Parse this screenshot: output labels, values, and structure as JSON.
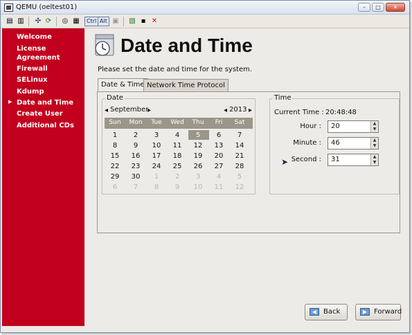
{
  "window": {
    "title": "QEMU (oeltest01)",
    "minimize": "–",
    "maximize": "□",
    "close": "✕"
  },
  "toolbar": {
    "ctrl": "Ctrl",
    "alt": "Alt",
    "close_icon": "✕"
  },
  "sidebar": {
    "items": [
      {
        "label": "Welcome",
        "current": false
      },
      {
        "label": "License Agreement",
        "current": false
      },
      {
        "label": "Firewall",
        "current": false
      },
      {
        "label": "SELinux",
        "current": false
      },
      {
        "label": "Kdump",
        "current": false
      },
      {
        "label": "Date and Time",
        "current": true
      },
      {
        "label": "Create User",
        "current": false
      },
      {
        "label": "Additional CDs",
        "current": false
      }
    ]
  },
  "page": {
    "title": "Date and Time",
    "instruction": "Please set the date and time for the system."
  },
  "tabs": [
    {
      "label": "Date & Time",
      "active": true
    },
    {
      "label": "Network Time Protocol",
      "active": false
    }
  ],
  "date": {
    "section_label": "Date",
    "month": "September",
    "year": "2013",
    "weekdays": [
      "Sun",
      "Mon",
      "Tue",
      "Wed",
      "Thu",
      "Fri",
      "Sat"
    ],
    "weeks": [
      [
        {
          "d": "1",
          "o": false
        },
        {
          "d": "2",
          "o": false
        },
        {
          "d": "3",
          "o": false
        },
        {
          "d": "4",
          "o": false
        },
        {
          "d": "5",
          "o": false,
          "s": true
        },
        {
          "d": "6",
          "o": false
        },
        {
          "d": "7",
          "o": false
        }
      ],
      [
        {
          "d": "8",
          "o": false
        },
        {
          "d": "9",
          "o": false
        },
        {
          "d": "10",
          "o": false
        },
        {
          "d": "11",
          "o": false
        },
        {
          "d": "12",
          "o": false
        },
        {
          "d": "13",
          "o": false
        },
        {
          "d": "14",
          "o": false
        }
      ],
      [
        {
          "d": "15",
          "o": false
        },
        {
          "d": "16",
          "o": false
        },
        {
          "d": "17",
          "o": false
        },
        {
          "d": "18",
          "o": false
        },
        {
          "d": "19",
          "o": false
        },
        {
          "d": "20",
          "o": false
        },
        {
          "d": "21",
          "o": false
        }
      ],
      [
        {
          "d": "22",
          "o": false
        },
        {
          "d": "23",
          "o": false
        },
        {
          "d": "24",
          "o": false
        },
        {
          "d": "25",
          "o": false
        },
        {
          "d": "26",
          "o": false
        },
        {
          "d": "27",
          "o": false
        },
        {
          "d": "28",
          "o": false
        }
      ],
      [
        {
          "d": "29",
          "o": false
        },
        {
          "d": "30",
          "o": false
        },
        {
          "d": "1",
          "o": true
        },
        {
          "d": "2",
          "o": true
        },
        {
          "d": "3",
          "o": true
        },
        {
          "d": "4",
          "o": true
        },
        {
          "d": "5",
          "o": true
        }
      ],
      [
        {
          "d": "6",
          "o": true
        },
        {
          "d": "7",
          "o": true
        },
        {
          "d": "8",
          "o": true
        },
        {
          "d": "9",
          "o": true
        },
        {
          "d": "10",
          "o": true
        },
        {
          "d": "11",
          "o": true
        },
        {
          "d": "12",
          "o": true
        }
      ]
    ]
  },
  "time": {
    "section_label": "Time",
    "current_label": "Current Time :",
    "current_value": "20:48:48",
    "hour_label": "Hour :",
    "hour_value": "20",
    "minute_label": "Minute :",
    "minute_value": "46",
    "second_label": "Second :",
    "second_value": "31"
  },
  "buttons": {
    "back": "Back",
    "forward": "Forward"
  }
}
